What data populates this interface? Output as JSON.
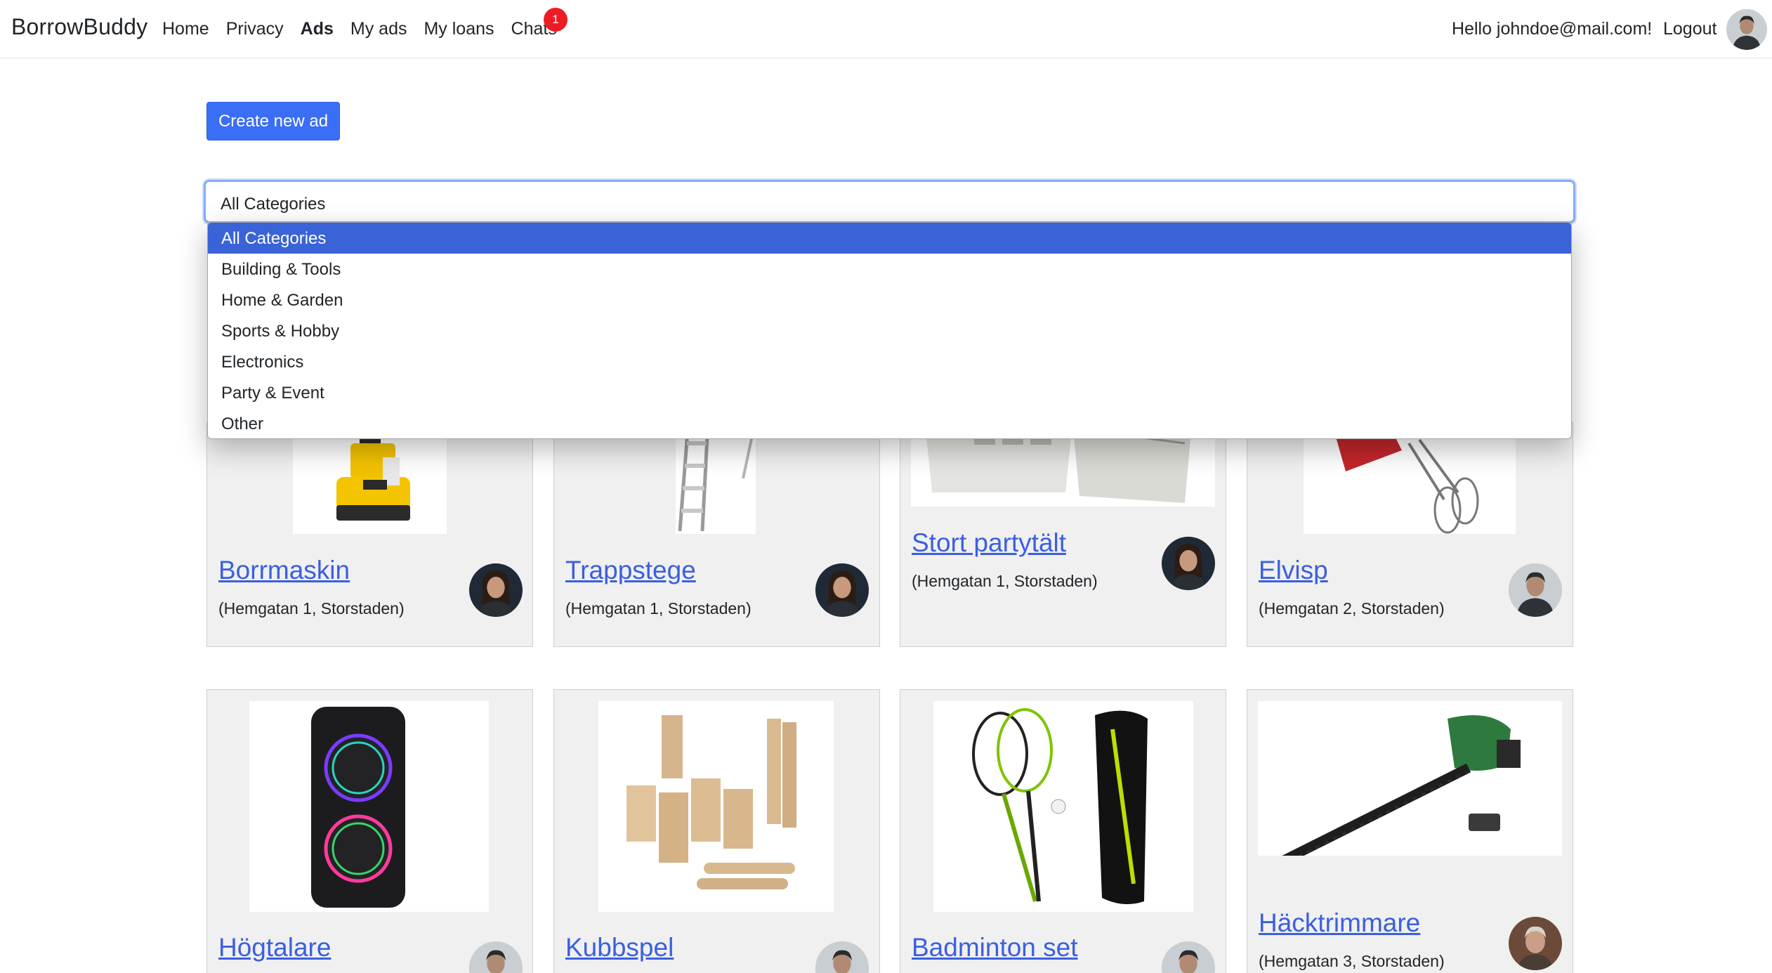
{
  "nav": {
    "brand": "BorrowBuddy",
    "links": [
      "Home",
      "Privacy",
      "Ads",
      "My ads",
      "My loans",
      "Chats"
    ],
    "active": "Ads",
    "chat_badge": "1",
    "greeting": "Hello johndoe@mail.com!",
    "logout": "Logout"
  },
  "actions": {
    "create_label": "Create new ad"
  },
  "filter": {
    "selected": "All Categories",
    "options": [
      "All Categories",
      "Building & Tools",
      "Home & Garden",
      "Sports & Hobby",
      "Electronics",
      "Party & Event",
      "Other"
    ]
  },
  "ads": [
    {
      "title": "Borrmaskin",
      "address": "(Hemgatan 1, Storstaden)",
      "image_icon": "drill-icon",
      "owner_avatar": "woman-avatar"
    },
    {
      "title": "Trappstege",
      "address": "(Hemgatan 1, Storstaden)",
      "image_icon": "ladder-icon",
      "owner_avatar": "woman-avatar"
    },
    {
      "title": "Stort partytält",
      "address": "(Hemgatan 1, Storstaden)",
      "image_icon": "party-tent-icon",
      "owner_avatar": "woman-avatar"
    },
    {
      "title": "Elvisp",
      "address": "(Hemgatan 2, Storstaden)",
      "image_icon": "hand-mixer-icon",
      "owner_avatar": "man-avatar"
    },
    {
      "title": "Högtalare",
      "address": "",
      "image_icon": "speaker-icon",
      "owner_avatar": "man-avatar"
    },
    {
      "title": "Kubbspel",
      "address": "",
      "image_icon": "kubb-game-icon",
      "owner_avatar": "man-avatar"
    },
    {
      "title": "Badminton set",
      "address": "",
      "image_icon": "badminton-icon",
      "owner_avatar": "man-avatar"
    },
    {
      "title": "Häcktrimmare",
      "address": "(Hemgatan 3, Storstaden)",
      "image_icon": "hedge-trimmer-icon",
      "owner_avatar": "old-man-avatar"
    }
  ],
  "colors": {
    "primary": "#3b6ef6",
    "link": "#3b5fe0",
    "badge": "#ed1c24",
    "dropdown_selected": "#3a63d8",
    "card_bg": "#f0f0f0"
  }
}
